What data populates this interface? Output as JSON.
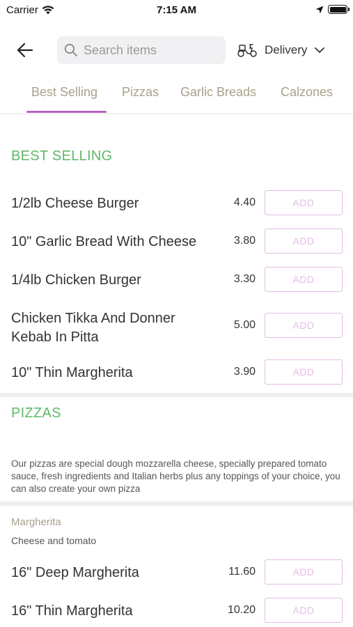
{
  "status_bar": {
    "carrier": "Carrier",
    "time": "7:15 AM"
  },
  "header": {
    "search_placeholder": "Search items",
    "delivery_label": "Delivery"
  },
  "tabs": [
    {
      "label": "Best Selling"
    },
    {
      "label": "Pizzas"
    },
    {
      "label": "Garlic Breads"
    },
    {
      "label": "Calzones"
    }
  ],
  "colors": {
    "accent": "#b563c0",
    "section_title": "#5fb86a",
    "tab_text": "#a8a08a",
    "add_button": "#e3bde6"
  },
  "best_selling": {
    "title": "BEST SELLING",
    "items": [
      {
        "name": "1/2lb Cheese Burger",
        "price": "4.40",
        "add": "ADD"
      },
      {
        "name": "10\" Garlic Bread With Cheese",
        "price": "3.80",
        "add": "ADD"
      },
      {
        "name": "1/4lb Chicken Burger",
        "price": "3.30",
        "add": "ADD"
      },
      {
        "name": "Chicken Tikka And Donner Kebab In Pitta",
        "price": "5.00",
        "add": "ADD"
      },
      {
        "name": "10\" Thin Margherita",
        "price": "3.90",
        "add": "ADD"
      }
    ]
  },
  "pizzas": {
    "title": "PIZZAS",
    "description": "Our pizzas are special dough mozzarella cheese, specially prepared tomato sauce, fresh ingredients and Italian herbs plus any toppings of your choice, you can also create your own pizza",
    "subcategory": {
      "name": "Margherita",
      "description": "Cheese and tomato"
    },
    "items": [
      {
        "name": "16\" Deep Margherita",
        "price": "11.60",
        "add": "ADD"
      },
      {
        "name": "16\" Thin Margherita",
        "price": "10.20",
        "add": "ADD"
      }
    ]
  }
}
